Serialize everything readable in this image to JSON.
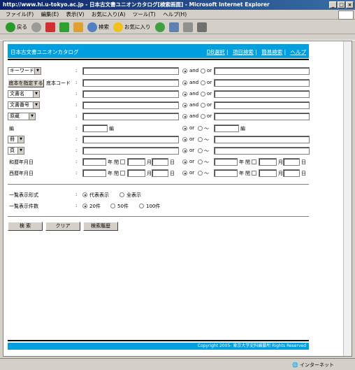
{
  "window": {
    "title": "http://www.hi.u-tokyo.ac.jp - 日本古文書ユニオンカタログ[検索画面] - Microsoft Internet Explorer"
  },
  "menu": [
    "ファイル(F)",
    "編集(E)",
    "表示(V)",
    "お気に入り(A)",
    "ツール(T)",
    "ヘルプ(H)"
  ],
  "toolbar": {
    "back": "戻る",
    "search": "検索",
    "favorites": "お気に入り"
  },
  "header": {
    "title": "日本古文書ユニオンカタログ",
    "links": [
      "DB選択",
      "項目検索",
      "簡易検索",
      "ヘルプ"
    ]
  },
  "form": {
    "colon": ":",
    "keyword_select": "キーワード",
    "base_button": "底本を指定する",
    "base_code_label": "底本コード",
    "doc_name_select": "文書名",
    "doc_number_select": "文書番号",
    "original_select": "原蔵",
    "hen_label": "編",
    "hen_unit": "編",
    "satsu_select": "冊",
    "page_select": "頁",
    "wareki_label": "和暦年月日",
    "seireki_label": "西暦年月日",
    "and": "and",
    "or": "or",
    "or_tilde": "or",
    "tilde": "〜",
    "nen": "年",
    "kan": "閏",
    "tsuki": "月",
    "hi": "日"
  },
  "display": {
    "format_label": "一覧表示形式",
    "format_opt1": "代表表示",
    "format_opt2": "全表示",
    "count_label": "一覧表示件数",
    "count_opt1": "20件",
    "count_opt2": "50件",
    "count_opt3": "100件"
  },
  "buttons": {
    "search": "検 索",
    "clear": "クリア",
    "history": "検索履歴"
  },
  "footer": {
    "copyright": "Copyright 2005- 東京大学史料編纂所 Rights Reserved"
  },
  "status": {
    "zone": "インターネット"
  },
  "colors": {
    "accent": "#00a0e0",
    "titlebar": "#0a246a"
  }
}
